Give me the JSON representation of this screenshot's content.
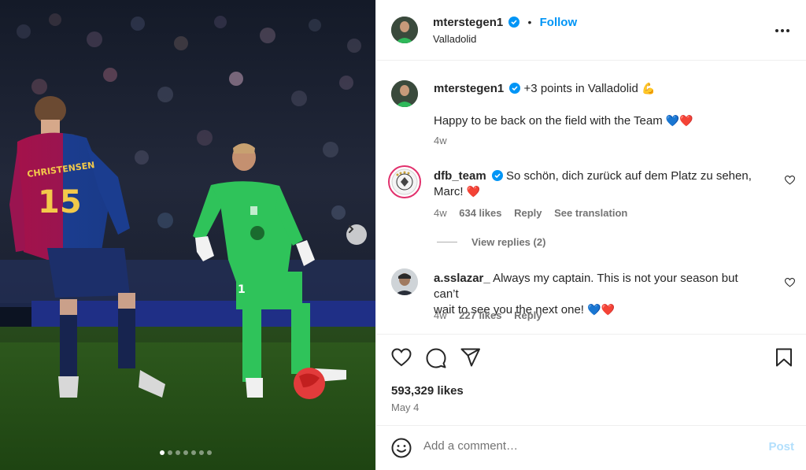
{
  "post": {
    "author": "mterstegen1",
    "follow_label": "Follow",
    "location": "Valladolid",
    "more_icon": "more-horizontal-icon",
    "verified_color": "#0095f6",
    "caption": {
      "username": "mterstegen1",
      "text": "+3 points in Valladolid",
      "emoji": "💪",
      "line2": "Happy to be back on the field with the Team",
      "hearts": "💙❤️",
      "age": "4w"
    },
    "image": {
      "carousel_dots": 7,
      "active_dot": 0,
      "next_icon": "chevron-right-icon",
      "jersey_name": "CHRISTENSEN",
      "jersey_number": "15",
      "keeper_number": "1"
    }
  },
  "comments": [
    {
      "username": "dfb_team",
      "verified": true,
      "text_line1": "So schön, dich zurück auf dem Platz zu sehen,",
      "text_line2": "Marc!",
      "emoji": "❤️",
      "age": "4w",
      "likes": "634 likes",
      "reply": "Reply",
      "translate": "See translation",
      "view_replies": "View replies (2)"
    },
    {
      "username": "a.sslazar_",
      "verified": false,
      "text_line1": "Always my captain. This is not your season but can’t",
      "text_line2": "wait to see you the next one!",
      "emoji": "💙❤️",
      "age": "4w",
      "likes": "227 likes",
      "reply": "Reply"
    }
  ],
  "actions": {
    "like_icon": "heart-icon",
    "comment_icon": "comment-icon",
    "share_icon": "share-icon",
    "save_icon": "bookmark-icon",
    "likes_count": "593,329 likes",
    "date": "May 4"
  },
  "composer": {
    "placeholder": "Add a comment…",
    "post_label": "Post",
    "emoji_icon": "emoji-icon"
  }
}
